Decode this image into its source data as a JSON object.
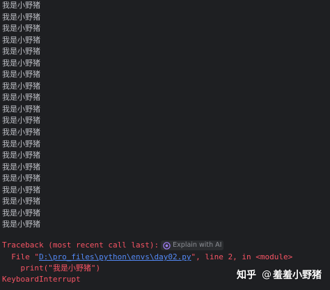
{
  "console": {
    "output_lines": [
      "我是小野猪",
      "我是小野猪",
      "我是小野猪",
      "我是小野猪",
      "我是小野猪",
      "我是小野猪",
      "我是小野猪",
      "我是小野猪",
      "我是小野猪",
      "我是小野猪",
      "我是小野猪",
      "我是小野猪",
      "我是小野猪",
      "我是小野猪",
      "我是小野猪",
      "我是小野猪",
      "我是小野猪",
      "我是小野猪",
      "我是小野猪",
      "我是小野猪"
    ],
    "traceback": {
      "header": "Traceback (most recent call last):",
      "explain_label": "Explain with AI",
      "file_prefix": "  File \"",
      "file_path": "D:\\pro_files\\python\\envs\\day02.py",
      "file_suffix": "\", line 2, in <module>",
      "code_line": "    print(\"我是小野猪\")",
      "exception": "KeyboardInterrupt"
    },
    "colors": {
      "background": "#1e1f22",
      "output_text": "#bcbec4",
      "error_text": "#f75464",
      "link": "#548af7"
    }
  },
  "watermark": {
    "platform": "知乎",
    "at": "@",
    "author": "羞羞小野猪"
  }
}
